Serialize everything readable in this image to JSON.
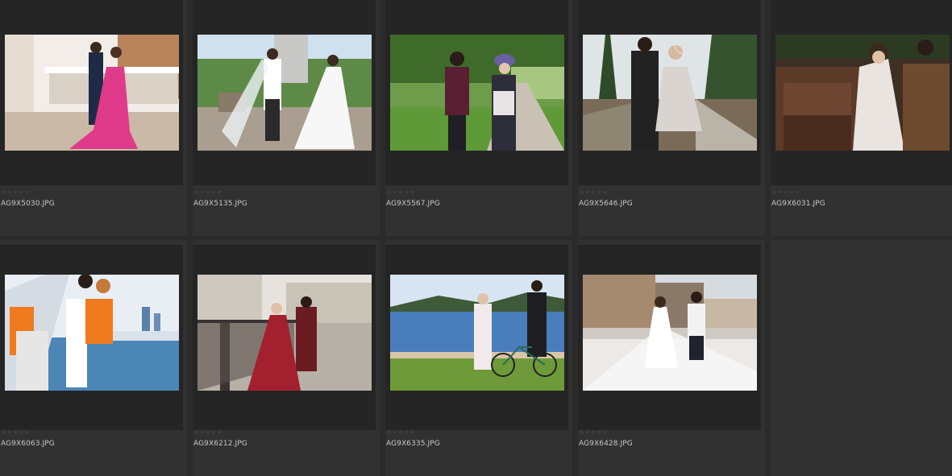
{
  "thumbnails": [
    {
      "filename": "AG9X5030.JPG",
      "rating": "★★★★★",
      "colors": {
        "sky": "#f2ede8",
        "ground": "#c9b9a6",
        "accent": "#e03a8a",
        "figure": "#1f2a44"
      }
    },
    {
      "filename": "AG9X5135.JPG",
      "rating": "★★★★★",
      "colors": {
        "sky": "#cfe0ef",
        "ground": "#a99e90",
        "accent": "#ffffff",
        "figure": "#2a2a2a"
      }
    },
    {
      "filename": "AG9X5567.JPG",
      "rating": "★★★★★",
      "colors": {
        "sky": "#6f9c4a",
        "ground": "#c9c2b4",
        "accent": "#5a1f33",
        "figure": "#2e2e3a"
      }
    },
    {
      "filename": "AG9X5646.JPG",
      "rating": "★★★★★",
      "colors": {
        "sky": "#dfe4e6",
        "ground": "#7a6b58",
        "accent": "#d9d4d0",
        "figure": "#222222"
      }
    },
    {
      "filename": "AG9X6031.JPG",
      "rating": "★★★★★",
      "colors": {
        "sky": "#3e2f24",
        "ground": "#5b3a28",
        "accent": "#e9e4df",
        "figure": "#6e4a2e"
      }
    },
    {
      "filename": "AG9X6063.JPG",
      "rating": "★★★★★",
      "colors": {
        "sky": "#e9eef5",
        "ground": "#4c86b6",
        "accent": "#f07a1e",
        "figure": "#e6e6e6"
      }
    },
    {
      "filename": "AG9X6212.JPG",
      "rating": "★★★★★",
      "colors": {
        "sky": "#e6e3df",
        "ground": "#b6b0a6",
        "accent": "#a3202e",
        "figure": "#3d3a38"
      }
    },
    {
      "filename": "AG9X6335.JPG",
      "rating": "★★★★★",
      "colors": {
        "sky": "#d7e4f2",
        "ground": "#6e9a3a",
        "accent": "#4a7dbc",
        "figure": "#1e1e22"
      }
    },
    {
      "filename": "AG9X6428.JPG",
      "rating": "★★★★★",
      "colors": {
        "sky": "#d6dbe0",
        "ground": "#ece9e6",
        "accent": "#ffffff",
        "figure": "#1f2330"
      }
    }
  ]
}
